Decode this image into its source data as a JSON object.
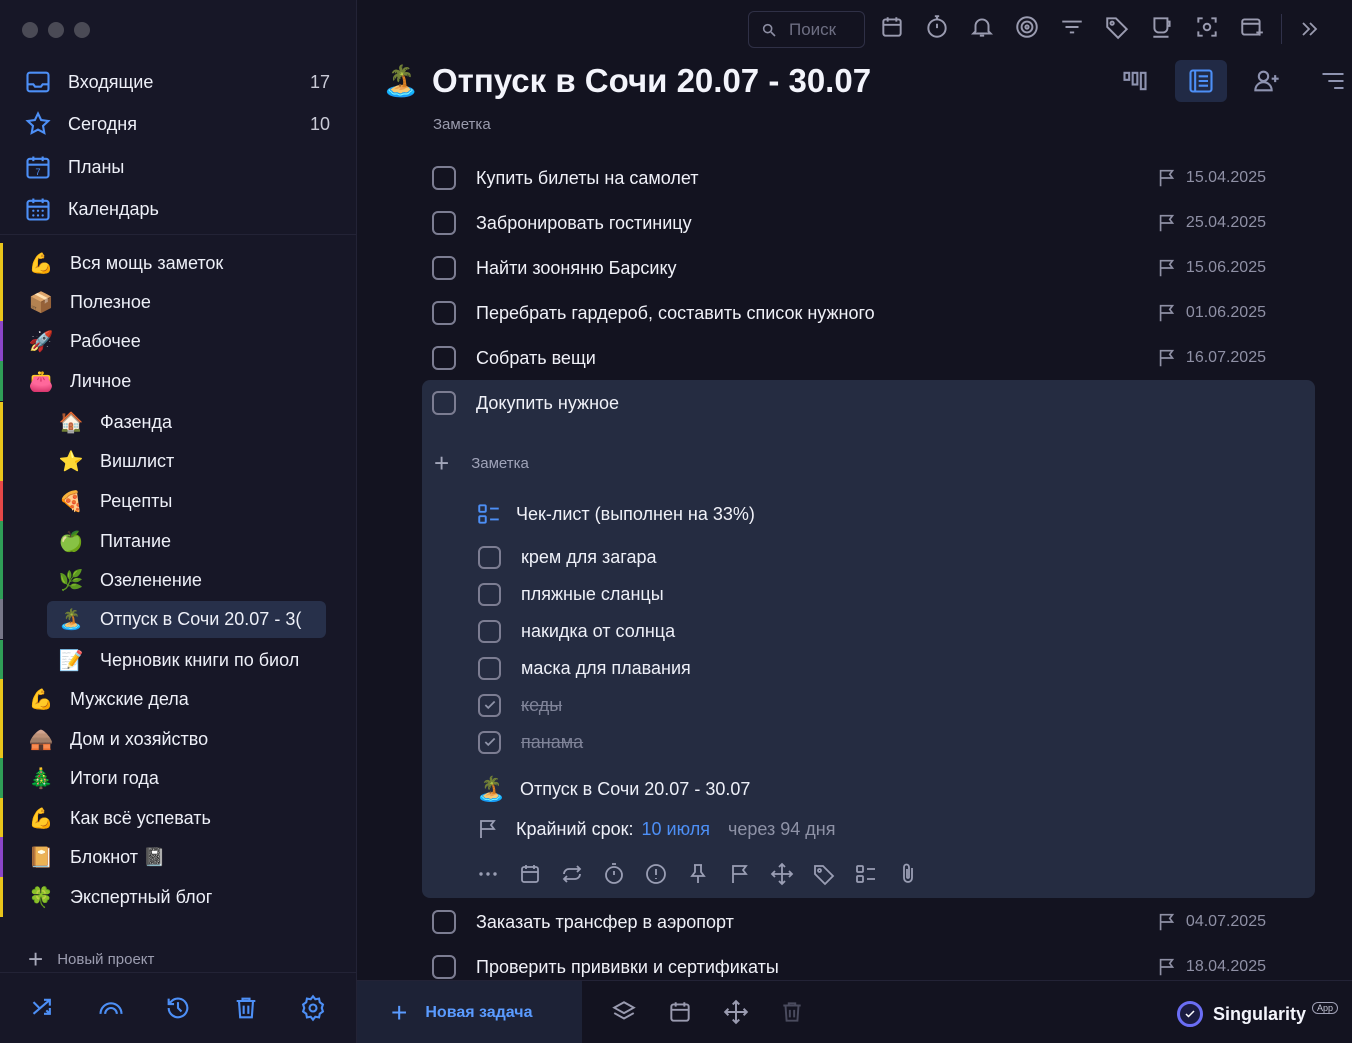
{
  "sidebar": {
    "system": [
      {
        "label": "Входящие",
        "count": "17"
      },
      {
        "label": "Сегодня",
        "count": "10"
      },
      {
        "label": "Планы",
        "count": ""
      },
      {
        "label": "Календарь",
        "count": ""
      }
    ],
    "projects": [
      {
        "emoji": "💪",
        "label": "Вся мощь заметок"
      },
      {
        "emoji": "📦",
        "label": "Полезное"
      },
      {
        "emoji": "🚀",
        "label": "Рабочее"
      },
      {
        "emoji": "👛",
        "label": "Личное"
      },
      {
        "emoji": "🏠",
        "label": "Фазенда"
      },
      {
        "emoji": "⭐",
        "label": "Вишлист"
      },
      {
        "emoji": "🍕",
        "label": "Рецепты"
      },
      {
        "emoji": "🍏",
        "label": "Питание"
      },
      {
        "emoji": "🌿",
        "label": "Озеленение"
      },
      {
        "emoji": "🏝️",
        "label": "Отпуск в Сочи 20.07 - 3("
      },
      {
        "emoji": "📝",
        "label": "Черновик книги по биол"
      },
      {
        "emoji": "💪",
        "label": "Мужские дела"
      },
      {
        "emoji": "🛖",
        "label": "Дом и хозяйство"
      },
      {
        "emoji": "🎄",
        "label": "Итоги года"
      },
      {
        "emoji": "💪",
        "label": "Как всё успевать"
      },
      {
        "emoji": "📔",
        "label": "Блокнот 📓"
      },
      {
        "emoji": "🍀",
        "label": "Экспертный блог"
      }
    ],
    "new_project": "Новый проект",
    "stripe_colors": [
      "#e9c51b",
      "#e9c51b",
      "#8b46c8",
      "#2f9e57",
      "#e9c51b",
      "#e9c51b",
      "#e54848",
      "#2f9e57",
      "#2f9e57",
      "#777788",
      "#2f9e57",
      "#e9c51b",
      "#e9c51b",
      "#2f9e57",
      "#e9c51b",
      "#8b46c8",
      "#e9c51b"
    ]
  },
  "header": {
    "search_placeholder": "Поиск",
    "title_emoji": "🏝️",
    "title": "Отпуск в Сочи 20.07 - 30.07",
    "note_label": "Заметка"
  },
  "tasks": [
    {
      "label": "Купить билеты на самолет",
      "date": "15.04.2025"
    },
    {
      "label": "Забронировать гостиницу",
      "date": "25.04.2025"
    },
    {
      "label": "Найти зооняню Барсику",
      "date": "15.06.2025"
    },
    {
      "label": "Перебрать гардероб, составить список нужного",
      "date": "01.06.2025"
    },
    {
      "label": "Собрать вещи",
      "date": "16.07.2025"
    }
  ],
  "expanded_task": {
    "label": "Докупить нужное",
    "note_placeholder": "Заметка",
    "checklist_title": "Чек-лист (выполнен на 33%)",
    "checklist": [
      {
        "label": "крем для загара",
        "done": false
      },
      {
        "label": "пляжные сланцы",
        "done": false
      },
      {
        "label": "накидка от солнца",
        "done": false
      },
      {
        "label": "маска для плавания",
        "done": false
      },
      {
        "label": "кеды",
        "done": true
      },
      {
        "label": "панама",
        "done": true
      }
    ],
    "project_emoji": "🏝️",
    "project": "Отпуск в Сочи 20.07 - 30.07",
    "deadline_label": "Крайний срок:",
    "deadline_value": "10 июля",
    "deadline_relative": "через 94 дня"
  },
  "tasks_after": [
    {
      "label": "Заказать трансфер в аэропорт",
      "date": "04.07.2025"
    },
    {
      "label": "Проверить прививки и сертификаты",
      "date": "18.04.2025"
    }
  ],
  "bottom": {
    "new_task": "Новая задача",
    "brand": "Singularity",
    "brand_badge": "App"
  },
  "colors": {
    "accent": "#4d8ff6",
    "background": "#131320",
    "sidebar": "#171727",
    "expanded": "#252c41"
  }
}
